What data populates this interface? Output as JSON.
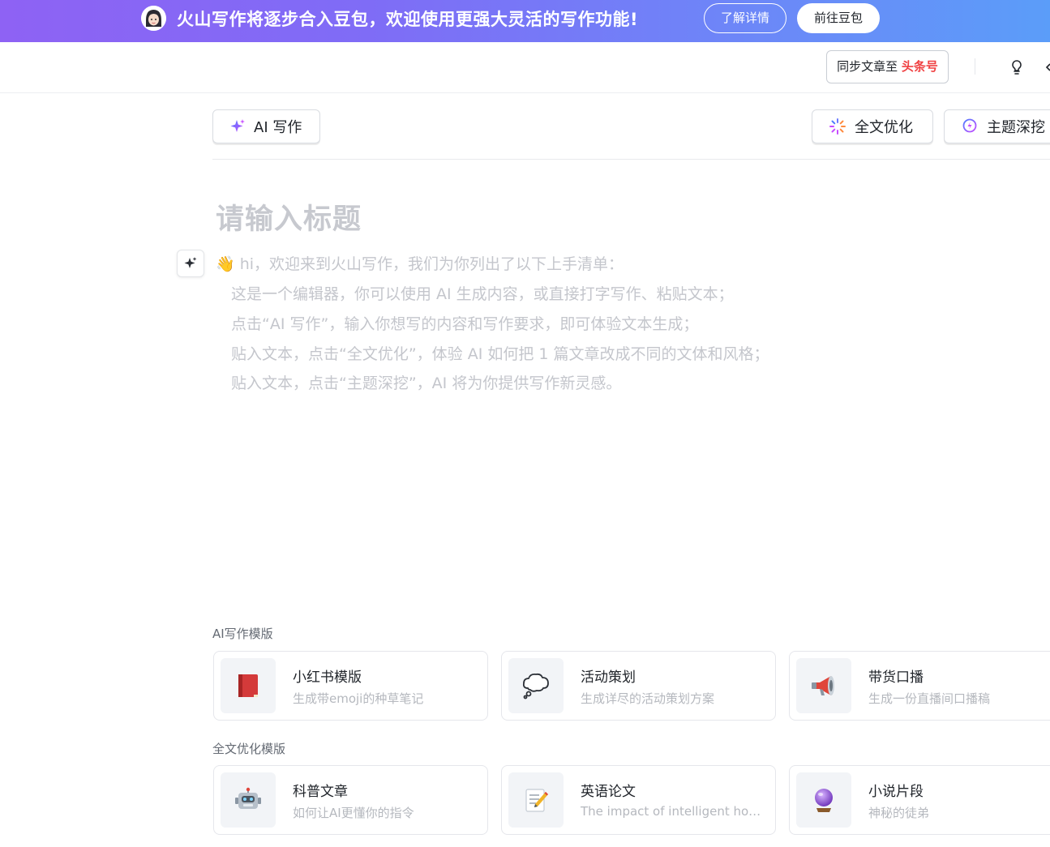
{
  "banner": {
    "message": "火山写作将逐步合入豆包，欢迎使用更强大灵活的写作功能!",
    "learn_more": "了解详情",
    "go_doubao": "前往豆包"
  },
  "header": {
    "sync_prefix": "同步文章至",
    "sync_brand": "头条号",
    "brand_color": "#f04142"
  },
  "toolbar": {
    "ai_write": "AI 写作",
    "full_optimize": "全文优化",
    "topic_dig": "主题深挖"
  },
  "editor": {
    "title_placeholder": "请输入标题",
    "guide_emoji": "👋",
    "guide_intro": "hi，欢迎来到火山写作，我们为你列出了以下上手清单：",
    "guide_lines": [
      "这是一个编辑器，你可以使用 AI 生成内容，或直接打字写作、粘贴文本；",
      "点击“AI 写作”，输入你想写的内容和写作要求，即可体验文本生成；",
      "贴入文本，点击“全文优化”，体验 AI 如何把 1 篇文章改成不同的文体和风格；",
      "贴入文本，点击“主题深挖”，AI 将为你提供写作新灵感。"
    ]
  },
  "templates": {
    "ai_section_label": "AI写作模版",
    "ai_cards": [
      {
        "icon": "📕",
        "icon_name": "red-book-icon",
        "title": "小红书模版",
        "desc": "生成带emoji的种草笔记"
      },
      {
        "icon": "💭",
        "icon_name": "thought-bubble-icon",
        "title": "活动策划",
        "desc": "生成详尽的活动策划方案"
      },
      {
        "icon": "📢",
        "icon_name": "megaphone-icon",
        "title": "带货口播",
        "desc": "生成一份直播间口播稿"
      }
    ],
    "optimize_section_label": "全文优化模版",
    "optimize_cards": [
      {
        "icon": "🤖",
        "icon_name": "robot-icon",
        "title": "科普文章",
        "desc": "如何让AI更懂你的指令"
      },
      {
        "icon": "📝",
        "icon_name": "memo-icon",
        "title": "英语论文",
        "desc": "The impact of intelligent hou…"
      },
      {
        "icon": "🔮",
        "icon_name": "crystal-ball-icon",
        "title": "小说片段",
        "desc": "神秘的徒弟"
      }
    ]
  }
}
